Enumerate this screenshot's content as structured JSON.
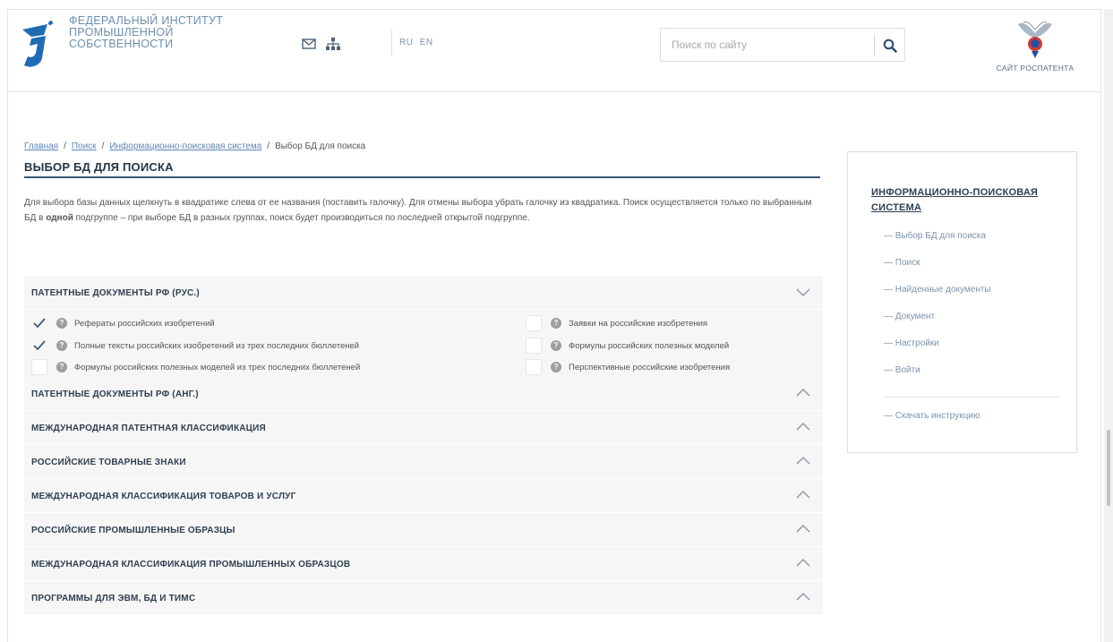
{
  "header": {
    "org_name": [
      "ФЕДЕРАЛЬНЫЙ ИНСТИТУТ",
      "ПРОМЫШЛЕННОЙ",
      "СОБСТВЕННОСТИ"
    ],
    "lang_ru": "RU",
    "lang_en": "EN",
    "search_placeholder": "Поиск по сайту",
    "rospatent_label": "САЙТ РОСПАТЕНТА",
    "icons": [
      "mail-icon",
      "sitemap-icon",
      "search-icon"
    ]
  },
  "breadcrumb": [
    "Главная",
    "Поиск",
    "Информационно-поисковая система",
    "Выбор БД для поиска"
  ],
  "page": {
    "title": "ВЫБОР БД ДЛЯ ПОИСКА",
    "intro_part1": "Для выбора базы данных щелкнуть в квадратике слева от ее названия (поставить галочку). Для отмены выбора убрать галочку из квадратика. Поиск осуществляется только по выбранным БД в ",
    "intro_bold": "одной",
    "intro_part2": " подгруппе – при выборе БД в разных группах, поиск будет производиться по последней открытой подгруппе."
  },
  "sections": [
    {
      "title": "ПАТЕНТНЫЕ ДОКУМЕНТЫ РФ (РУС.)",
      "expanded": true,
      "items_left": [
        {
          "label": "Рефераты российских изобретений",
          "checked": true
        },
        {
          "label": "Полные тексты российских изобретений из трех последних бюллетеней",
          "checked": true
        },
        {
          "label": "Формулы российских полезных моделей из трех последних бюллетеней",
          "checked": false
        }
      ],
      "items_right": [
        {
          "label": "Заявки на российские изобретения",
          "checked": false
        },
        {
          "label": "Формулы российских полезных моделей",
          "checked": false
        },
        {
          "label": "Перспективные российские изобретения",
          "checked": false
        }
      ]
    },
    {
      "title": "ПАТЕНТНЫЕ ДОКУМЕНТЫ РФ (АНГ.)",
      "expanded": false
    },
    {
      "title": "МЕЖДУНАРОДНАЯ ПАТЕНТНАЯ КЛАССИФИКАЦИЯ",
      "expanded": false
    },
    {
      "title": "РОССИЙСКИЕ ТОВАРНЫЕ ЗНАКИ",
      "expanded": false
    },
    {
      "title": "МЕЖДУНАРОДНАЯ КЛАССИФИКАЦИЯ ТОВАРОВ И УСЛУГ",
      "expanded": false
    },
    {
      "title": "РОССИЙСКИЕ ПРОМЫШЛЕННЫЕ ОБРАЗЦЫ",
      "expanded": false
    },
    {
      "title": "МЕЖДУНАРОДНАЯ КЛАССИФИКАЦИЯ ПРОМЫШЛЕННЫХ ОБРАЗЦОВ",
      "expanded": false
    },
    {
      "title": "ПРОГРАММЫ ДЛЯ ЭВМ, БД И ТИМС",
      "expanded": false
    }
  ],
  "help_glyph": "?",
  "sidebar": {
    "title": "ИНФОРМАЦИОННО-ПОИСКОВАЯ СИСТЕМА",
    "items": [
      "— Выбор БД для поиска",
      "— Поиск",
      "— Найденные документы",
      "— Документ",
      "— Настройки",
      "— Войти"
    ],
    "download": "— Скачать инструкцию"
  },
  "colors": {
    "accent_blue": "#1f6bb5",
    "title_line": "#3a556f",
    "link": "#5e86b8",
    "section_bg": "#f6f6f6",
    "check": "#3b5a78"
  }
}
